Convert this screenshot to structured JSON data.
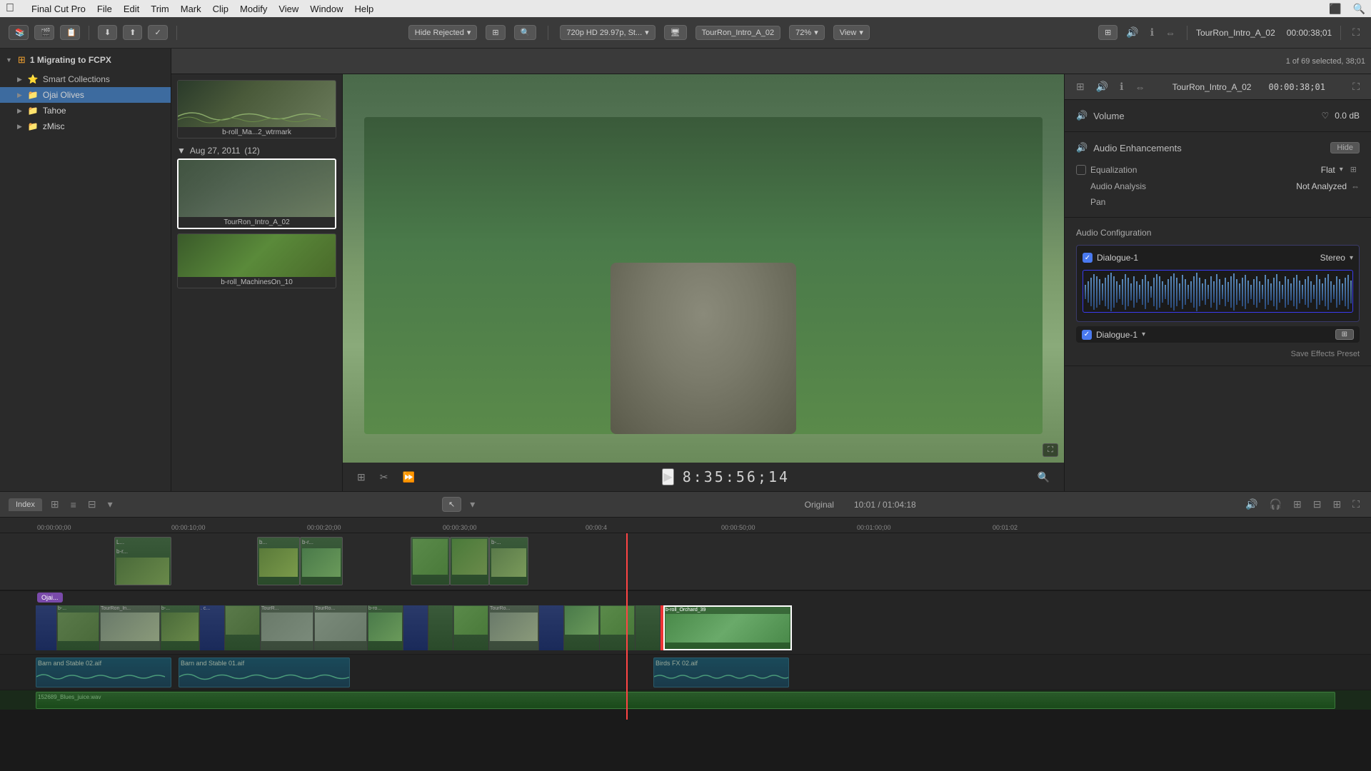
{
  "menubar": {
    "apple": "⌘",
    "items": [
      "Final Cut Pro",
      "File",
      "Edit",
      "Trim",
      "Mark",
      "Clip",
      "Modify",
      "View",
      "Window",
      "Help"
    ]
  },
  "toolbar": {
    "filter_label": "Hide Rejected",
    "resolution": "720p HD 29.97p, St...",
    "clip_name": "TourRon_Intro_A_02",
    "zoom": "72%",
    "view_label": "View",
    "timecode": "00:00:38;01",
    "clip_display": "TourRon_Intro_A_02"
  },
  "sidebar": {
    "project": "1 Migrating to FCPX",
    "smart_collections_label": "Smart Collections",
    "items": [
      {
        "label": "Ojai Olives",
        "type": "folder",
        "active": true
      },
      {
        "label": "Tahoe",
        "type": "folder"
      },
      {
        "label": "zMisc",
        "type": "folder"
      }
    ]
  },
  "browser": {
    "date_group": "Aug 27, 2011",
    "clip_count": "(12)",
    "clips": [
      {
        "name": "b-roll_Ma...2_wtrmark",
        "type": "broll"
      },
      {
        "name": "TourRon_Intro_A_02",
        "type": "person",
        "selected": true
      },
      {
        "name": "b-roll_MachinesOn_10",
        "type": "broll"
      }
    ],
    "selection_info": "1 of 69 selected, 38;01"
  },
  "viewer": {
    "timecode": "8:35:56;14",
    "duration": "10:01 / 01:04:18",
    "label": "Original"
  },
  "inspector": {
    "title": "TourRon_Intro_A_02",
    "timecode": "00:00:38;01",
    "volume_label": "Volume",
    "volume_value": "0.0 dB",
    "audio_enhancements_label": "Audio Enhancements",
    "hide_label": "Hide",
    "equalization_label": "Equalization",
    "equalization_value": "Flat",
    "audio_analysis_label": "Audio Analysis",
    "audio_analysis_value": "Not Analyzed",
    "pan_label": "Pan",
    "audio_config_label": "Audio Configuration",
    "dialogue1_label": "Dialogue-1",
    "stereo_label": "Stereo",
    "save_effects_preset": "Save Effects Preset"
  },
  "timeline": {
    "index_tab": "Index",
    "timecode_display": "Original",
    "duration_display": "10:01 / 01:04:18",
    "markers": [
      "00:00:00;00",
      "00:00:10;00",
      "00:00:20;00",
      "00:00:30;00",
      "00:00:50;00",
      "00:01:00;00",
      "00:01:02",
      "00:0"
    ],
    "audio_clips": [
      {
        "label": "Barn and Stable 02.aif"
      },
      {
        "label": "Barn and Stable 01.aif"
      },
      {
        "label": "Birds FX 02.aif"
      }
    ],
    "bottom_clip": "152689_Blues_juice.wav",
    "tag": "Ojai...",
    "selected_clip": "b-roll_Orchard_39"
  },
  "icons": {
    "play": "▶",
    "triangle_right": "▶",
    "triangle_down": "▼",
    "chevron_down": "▾",
    "grid": "⊞",
    "search": "⌕",
    "check": "✓",
    "speaker": "♪",
    "info": "ℹ",
    "arrows": "⇔"
  }
}
